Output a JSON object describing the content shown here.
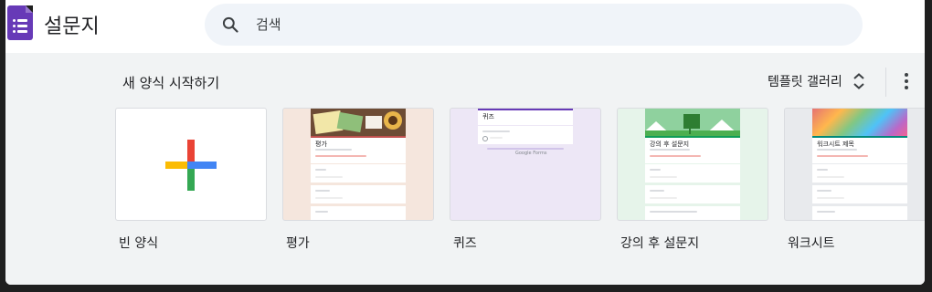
{
  "header": {
    "app_title": "설문지",
    "search_placeholder": "검색"
  },
  "gallery": {
    "section_title": "새 양식 시작하기",
    "toggle_label": "템플릿 갤러리",
    "templates": [
      {
        "label": "빈 양식"
      },
      {
        "label": "평가",
        "preview_title": "평가"
      },
      {
        "label": "퀴즈",
        "preview_title": "퀴즈",
        "preview_footer": "Google Forms"
      },
      {
        "label": "강의 후 설문지",
        "preview_title": "강의 후 설문지"
      },
      {
        "label": "워크시트",
        "preview_title": "워크시트 제목"
      }
    ]
  },
  "colors": {
    "brand": "#673ab7",
    "plus_red": "#ea4335",
    "plus_blue": "#4285f4",
    "plus_green": "#34a853",
    "plus_yellow": "#fbbc04"
  }
}
